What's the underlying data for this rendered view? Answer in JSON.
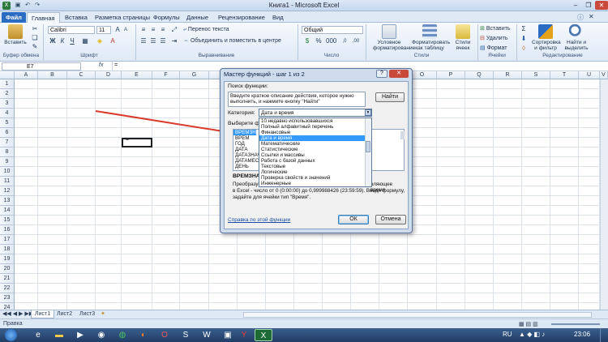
{
  "window": {
    "title": "Книга1 - Microsoft Excel"
  },
  "tabs": [
    "Файл",
    "Главная",
    "Вставка",
    "Разметка страницы",
    "Формулы",
    "Данные",
    "Рецензирование",
    "Вид"
  ],
  "ribbon": {
    "groups": [
      "Буфер обмена",
      "Шрифт",
      "Выравнивание",
      "Число",
      "Стили",
      "Ячейки",
      "Редактирование"
    ],
    "font_name": "Calibri",
    "font_size": "11",
    "wrap_text": "Перенос текста",
    "merge_center": "Объединить и поместить в центре",
    "number_format": "Общий",
    "insert_label": "Вставить",
    "cond_format": [
      "Условное",
      "форматирование"
    ],
    "format_table": [
      "Форматировать",
      "как таблицу"
    ],
    "cell_styles": [
      "Стили",
      "ячеек"
    ],
    "cells_insert": "Вставить",
    "cells_delete": "Удалить",
    "cells_format": "Формат",
    "sort_filter": [
      "Сортировка",
      "и фильтр"
    ],
    "find_select": [
      "Найти и",
      "выделить"
    ],
    "bold": "Ж",
    "italic": "К",
    "underline": "Ч"
  },
  "formula_bar": {
    "name_box": "E7",
    "fx": "fx",
    "content": "="
  },
  "columns": [
    "A",
    "B",
    "C",
    "D",
    "E",
    "F",
    "G",
    "H",
    "I",
    "J",
    "K",
    "L",
    "M",
    "N",
    "O",
    "P",
    "Q",
    "R",
    "S",
    "T",
    "U",
    "V"
  ],
  "rows": [
    "1",
    "2",
    "3",
    "4",
    "5",
    "6",
    "7",
    "8",
    "9",
    "10",
    "11",
    "12",
    "13",
    "14",
    "15",
    "16",
    "17",
    "18",
    "19",
    "20",
    "21",
    "22",
    "23",
    "24"
  ],
  "cell_e7": "=",
  "sheets": [
    "Лист1",
    "Лист2",
    "Лист3"
  ],
  "status": {
    "mode": "Правка"
  },
  "taskbar": {
    "lang": "RU",
    "time": "23:06"
  },
  "dialog": {
    "title": "Мастер функций - шаг 1 из 2",
    "search_label": "Поиск функции:",
    "search_value": "Введите краткое описание действия, которое нужно выполнить, и нажмите кнопку \"Найти\"",
    "find_button": "Найти",
    "category_label": "Категория:",
    "category_value": "Дата и время",
    "choose_label": "Выберите ф",
    "categories": [
      "10 недавно использовавшихся",
      "Полный алфавитный перечень",
      "Финансовые",
      "Дата и время",
      "Математические",
      "Статистические",
      "Ссылки и массивы",
      "Работа с базой данных",
      "Текстовые",
      "Логические",
      "Проверка свойств и значений",
      "Инженерные"
    ],
    "selected_index": 3,
    "functions": [
      "ВРЕМЗНАЧ",
      "ВРЕМ",
      "ГОД",
      "ДАТА",
      "ДАТАЗНАЧ",
      "ДАТАМЕС",
      "ДЕНЬ"
    ],
    "func_name": "ВРЕМЗНАЧ",
    "desc_line1": "Преобразуе",
    "desc_tail1": "вляющее время",
    "desc_line2": "в Excel - число от 0 (0:00:00) до 0,999988426 (23:59:59). Введя формулу,",
    "desc_line3": "задайте для ячейки тип \"Время\".",
    "help_link": "Справка по этой функции",
    "ok": "ОК",
    "cancel": "Отмена"
  }
}
